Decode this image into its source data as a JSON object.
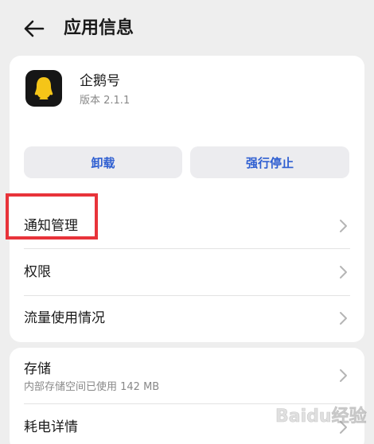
{
  "header": {
    "title": "应用信息",
    "back_icon": "back-arrow-icon"
  },
  "app": {
    "name": "企鹅号",
    "version": "版本 2.1.1",
    "icon": "penguin-app-icon",
    "icon_color": "#f5c518"
  },
  "actions": {
    "uninstall_label": "卸载",
    "force_stop_label": "强行停止",
    "accent_color": "#2f5fd1"
  },
  "list": {
    "notifications_label": "通知管理",
    "permissions_label": "权限",
    "data_usage_label": "流量使用情况"
  },
  "storage": {
    "label": "存储",
    "detail": "内部存储空间已使用 142 MB"
  },
  "power": {
    "label": "耗电详情"
  },
  "annotation": {
    "highlight_color": "#e8333a"
  },
  "watermark": {
    "text": "Baidu经验"
  }
}
